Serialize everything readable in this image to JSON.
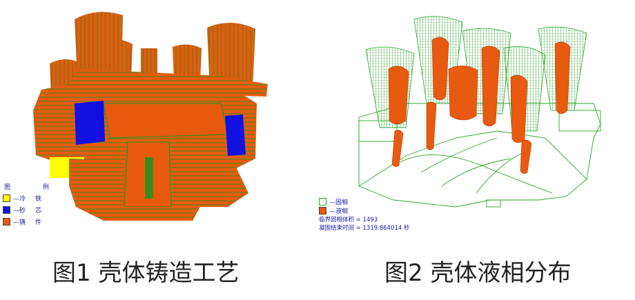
{
  "figure1": {
    "caption": "图1 壳体铸造工艺",
    "legend": {
      "title_left": "图",
      "title_right": "例",
      "items": [
        {
          "label": "—冷",
          "suffix": "铁",
          "color": "#ffff00"
        },
        {
          "label": "—砂",
          "suffix": "芯",
          "color": "#1010e0"
        },
        {
          "label": "—铸",
          "suffix": "件",
          "color": "#e85a10"
        }
      ]
    }
  },
  "figure2": {
    "caption": "图2 壳体液相分布",
    "legend": {
      "items": [
        {
          "label": "—固相",
          "color": "#ffffff"
        },
        {
          "label": "—液相",
          "color": "#e85a10"
        }
      ]
    },
    "info_lines": [
      "临界固相体积 = 1493",
      "凝固结束时间 = 1319.864014 秒"
    ]
  },
  "colors": {
    "casting": "#e85a10",
    "casting_line": "#2e8b1a",
    "core": "#1010e0",
    "chill": "#ffff00",
    "solid_mesh": "#2aa52a",
    "legend_text": "#1a1aa6"
  }
}
